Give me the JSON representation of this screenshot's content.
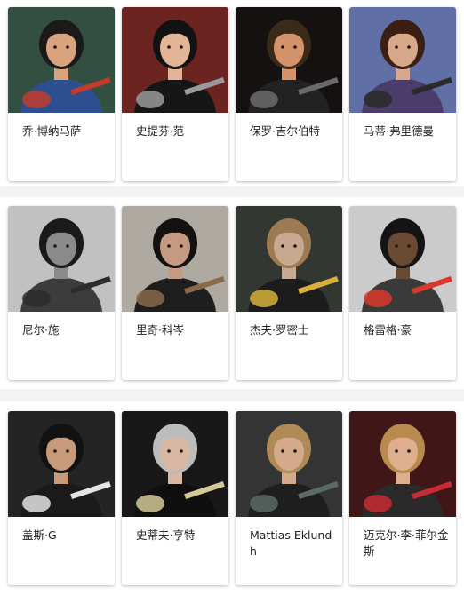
{
  "guitarists": [
    {
      "name": "乔·博纳马萨",
      "image": "guitarist-photo",
      "bg": "#3a5a4a",
      "skin": "#d9a37e",
      "hair": "#1c1a18",
      "shirt": "#2d4f8f",
      "accent": "#c33b2b"
    },
    {
      "name": "史提芬·范",
      "image": "guitarist-photo",
      "bg": "#7a2a24",
      "skin": "#e2b596",
      "hair": "#121212",
      "shirt": "#161616",
      "accent": "#9a9a9a"
    },
    {
      "name": "保罗·吉尔伯特",
      "image": "guitarist-photo",
      "bg": "#1a1414",
      "skin": "#d4936a",
      "hair": "#3a2a1a",
      "shirt": "#222222",
      "accent": "#6a6a6a"
    },
    {
      "name": "马蒂·弗里德曼",
      "image": "guitarist-photo",
      "bg": "#6f7fbf",
      "skin": "#d8a88a",
      "hair": "#3b1f12",
      "shirt": "#4b3d6a",
      "accent": "#2a2a2a"
    },
    {
      "name": "尼尔·施",
      "image": "guitarist-photo",
      "bg": "#dcdcdc",
      "skin": "#8a8a8a",
      "hair": "#1a1a1a",
      "shirt": "#3c3c3c",
      "accent": "#2c2c2c"
    },
    {
      "name": "里奇·科岑",
      "image": "guitarist-photo",
      "bg": "#c8c2b8",
      "skin": "#c49a82",
      "hair": "#141210",
      "shirt": "#1e1e1e",
      "accent": "#8b6a4a"
    },
    {
      "name": "杰夫·罗密士",
      "image": "guitarist-photo",
      "bg": "#3b3f3a",
      "skin": "#c8a88e",
      "hair": "#9c7a52",
      "shirt": "#1c1c1c",
      "accent": "#d6b03a"
    },
    {
      "name": "格雷格·豪",
      "image": "guitarist-photo",
      "bg": "#e8e8e8",
      "skin": "#6b4a34",
      "hair": "#141414",
      "shirt": "#3a3a3a",
      "accent": "#d83a2a"
    },
    {
      "name": "盖斯·G",
      "image": "guitarist-photo",
      "bg": "#2a2a2a",
      "skin": "#c89a7a",
      "hair": "#121212",
      "shirt": "#1a1a1a",
      "accent": "#e4e4e4"
    },
    {
      "name": "史蒂夫·亨特",
      "image": "guitarist-photo",
      "bg": "#1c1c1c",
      "skin": "#d8b8a2",
      "hair": "#bcbcbc",
      "shirt": "#0f0f0f",
      "accent": "#d4c896"
    },
    {
      "name": "Mattias Eklundh",
      "image": "guitarist-photo",
      "bg": "#3c3c3c",
      "skin": "#d4aa8a",
      "hair": "#b08a56",
      "shirt": "#1e1e1e",
      "accent": "#5a6a64"
    },
    {
      "name": "迈克尔·李·菲尔金斯",
      "image": "guitarist-photo",
      "bg": "#4a1a1a",
      "skin": "#deae8e",
      "hair": "#b88a4e",
      "shirt": "#2a2a2a",
      "accent": "#c82a36"
    }
  ]
}
